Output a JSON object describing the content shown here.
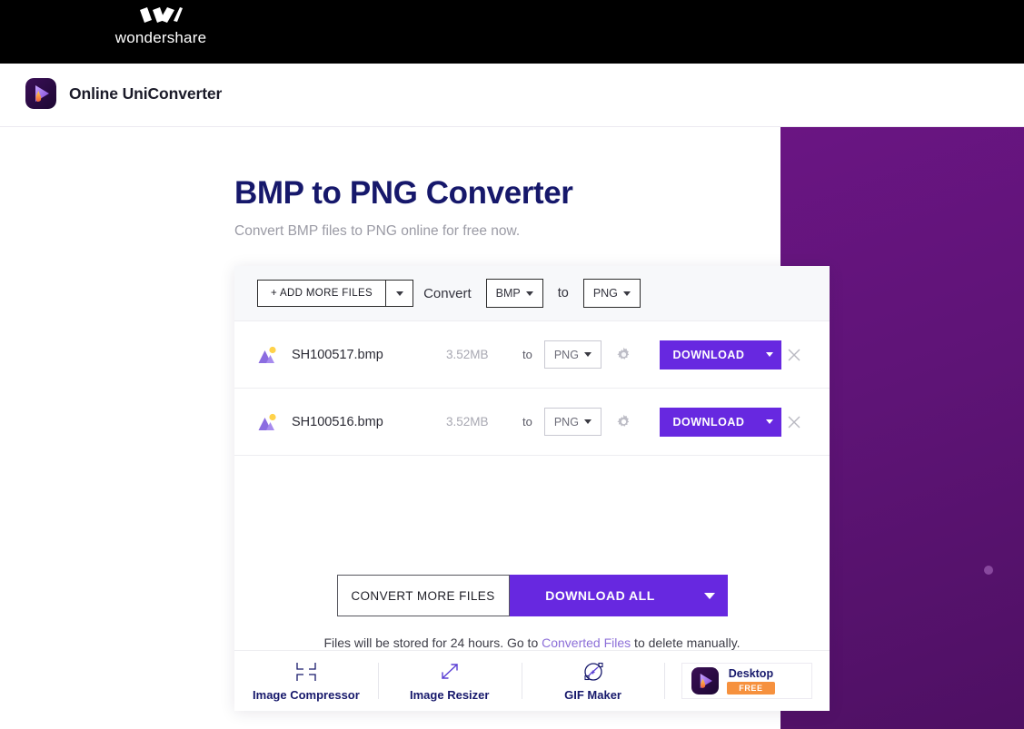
{
  "brand": {
    "name": "wondershare",
    "logo_icon": "wondershare-w-mark"
  },
  "nav": {
    "product_title": "Online UniConverter",
    "product_icon": "uniconverter-play-flame-icon"
  },
  "hero": {
    "title": "BMP to PNG Converter",
    "subtitle": "Convert BMP files to PNG online for free now."
  },
  "toolbar": {
    "add_files_label": "+ ADD MORE FILES",
    "add_files_caret_icon": "chevron-down-icon",
    "convert_label": "Convert",
    "source_format": "BMP",
    "to_label": "to",
    "target_format": "PNG"
  },
  "files": [
    {
      "icon": "image-file-icon",
      "name": "SH100517.bmp",
      "size": "3.52MB",
      "to_label": "to",
      "format": "PNG",
      "settings_icon": "gear-icon",
      "download_label": "DOWNLOAD",
      "download_caret_icon": "chevron-down-icon",
      "remove_icon": "close-icon"
    },
    {
      "icon": "image-file-icon",
      "name": "SH100516.bmp",
      "size": "3.52MB",
      "to_label": "to",
      "format": "PNG",
      "settings_icon": "gear-icon",
      "download_label": "DOWNLOAD",
      "download_caret_icon": "chevron-down-icon",
      "remove_icon": "close-icon"
    }
  ],
  "actions": {
    "convert_more_label": "CONVERT MORE FILES",
    "download_all_label": "DOWNLOAD ALL",
    "download_all_caret_icon": "chevron-down-icon"
  },
  "storage_note": {
    "prefix": "Files will be stored for 24 hours. Go to ",
    "link": "Converted Files",
    "suffix": " to delete manually."
  },
  "footer_tools": [
    {
      "label": "Image Compressor",
      "icon": "compress-corners-icon"
    },
    {
      "label": "Image Resizer",
      "icon": "resize-diagonal-arrows-icon"
    },
    {
      "label": "GIF Maker",
      "icon": "gif-maker-icon"
    }
  ],
  "desktop_promo": {
    "icon": "uniconverter-play-flame-icon",
    "title": "Desktop",
    "badge": "FREE"
  },
  "colors": {
    "accent_purple": "#6728e0",
    "title_navy": "#16186b",
    "panel_purple": "#5f1477",
    "badge_orange": "#f6913e",
    "link_purple": "#8c6fd8"
  }
}
